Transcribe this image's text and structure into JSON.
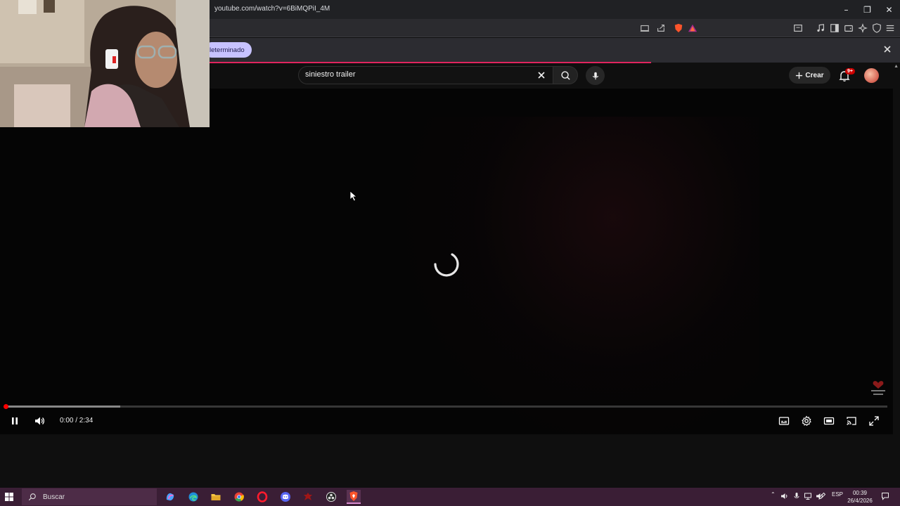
{
  "browser": {
    "url": "youtube.com/watch?v=6BiMQPiI_4M",
    "window_controls": {
      "minimize": "–",
      "restore": "❐",
      "close": "✕"
    }
  },
  "notification": {
    "pill_label": "leterminado"
  },
  "youtube": {
    "search_query": "siniestro trailer",
    "create_label": "Crear",
    "notif_badge": "9+",
    "player": {
      "time": "0:00 / 2:34",
      "buffered_fraction": 0.13,
      "played_fraction": 0.0,
      "state": "loading"
    }
  },
  "taskbar": {
    "search_placeholder": "Buscar",
    "language": "ESP",
    "time": "00:39",
    "date": "26/4/2026"
  },
  "colors": {
    "accent_red": "#ff0000",
    "taskbar": "#3a1e35",
    "pill": "#c7c2ff",
    "loadbar": "#e0245e"
  },
  "icons": [
    "windows-start-icon",
    "search-icon",
    "copilot-icon",
    "edge-icon",
    "file-explorer-icon",
    "chrome-icon",
    "opera-icon",
    "discord-icon",
    "game-icon",
    "obs-icon",
    "brave-icon",
    "mic-icon",
    "bell-icon",
    "plus-icon",
    "close-icon",
    "pause-icon",
    "volume-icon",
    "subtitles-icon",
    "settings-icon",
    "theater-icon",
    "cast-icon",
    "fullscreen-icon"
  ]
}
